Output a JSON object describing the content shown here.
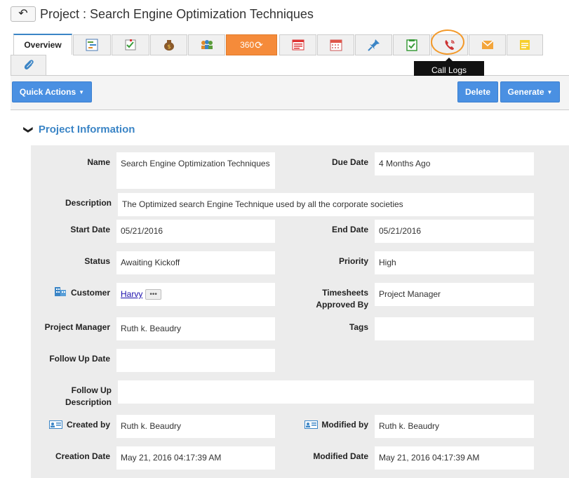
{
  "header": {
    "back_icon": "arrow-left-icon",
    "title": "Project : Search Engine Optimization Techniques"
  },
  "tabs": {
    "overview": "Overview",
    "t360": "360",
    "icons": [
      "gantt-icon",
      "tasks-icon",
      "money-bag-icon",
      "contacts-icon",
      "360-icon",
      "notes-list-icon",
      "calendar-icon",
      "pin-icon",
      "checklist-icon",
      "phone-icon",
      "email-icon",
      "sticky-note-icon",
      "attachment-icon"
    ],
    "colors": {
      "accent": "#3b85c6",
      "orange": "#f58b3a",
      "ring": "#f39a2b"
    }
  },
  "tooltip": "Call Logs",
  "toolbar": {
    "quick_actions": "Quick Actions",
    "delete": "Delete",
    "generate": "Generate"
  },
  "section": {
    "title": "Project Information"
  },
  "fields": {
    "name": {
      "label": "Name",
      "value": "Search Engine Optimization Techniques"
    },
    "due_date": {
      "label": "Due Date",
      "value": "4 Months Ago"
    },
    "description": {
      "label": "Description",
      "value": "The Optimized search Engine Technique used by all the corporate societies"
    },
    "start_date": {
      "label": "Start Date",
      "value": "05/21/2016"
    },
    "end_date": {
      "label": "End Date",
      "value": "05/21/2016"
    },
    "status": {
      "label": "Status",
      "value": "Awaiting Kickoff"
    },
    "priority": {
      "label": "Priority",
      "value": "High"
    },
    "customer": {
      "label": "Customer",
      "value": "Harvy",
      "more": "•••"
    },
    "timesheets": {
      "label": "Timesheets Approved By",
      "value": "Project Manager"
    },
    "project_manager": {
      "label": "Project Manager",
      "value": "Ruth k. Beaudry"
    },
    "tags": {
      "label": "Tags",
      "value": ""
    },
    "follow_up_date": {
      "label": "Follow Up Date",
      "value": ""
    },
    "follow_up_description": {
      "label": "Follow Up Description",
      "value": ""
    },
    "created_by": {
      "label": "Created by",
      "value": "Ruth k. Beaudry"
    },
    "modified_by": {
      "label": "Modified by",
      "value": "Ruth k. Beaudry"
    },
    "creation_date": {
      "label": "Creation Date",
      "value": "May 21, 2016 04:17:39 AM"
    },
    "modified_date": {
      "label": "Modified Date",
      "value": "May 21, 2016 04:17:39 AM"
    }
  }
}
